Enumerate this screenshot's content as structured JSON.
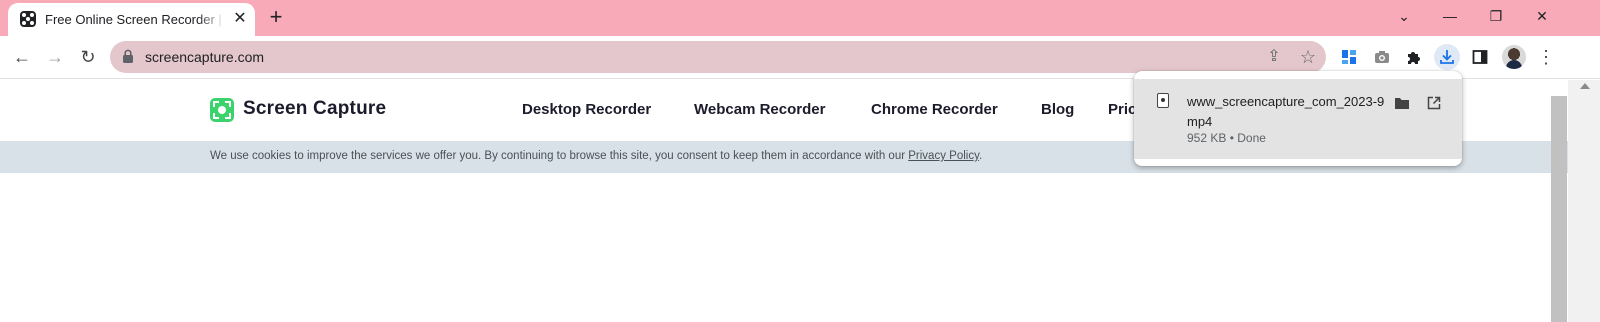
{
  "browser": {
    "tab": {
      "title": "Free Online Screen Recorder | Online Screen Capture",
      "close_glyph": "✕",
      "favicon": "screencapture-favicon-icon"
    },
    "new_tab_glyph": "+",
    "window_controls": {
      "tab_search": "⌄",
      "minimize": "—",
      "restore": "❐",
      "close": "✕"
    },
    "toolbar": {
      "back_glyph": "←",
      "forward_glyph": "→",
      "reload_glyph": "↻",
      "url": "screencapture.com",
      "share_glyph": "⇪",
      "bookmark_glyph": "☆",
      "menu_glyph": "⋮"
    },
    "accent_color": "#f8aab8"
  },
  "page": {
    "logo_text": "Screen Capture",
    "nav": [
      "Desktop Recorder",
      "Webcam Recorder",
      "Chrome Recorder",
      "Blog",
      "Pricing"
    ],
    "cookie": {
      "text": "We use cookies to improve the services we offer you. By continuing to browse this site, you consent to keep them in accordance with our ",
      "link": "Privacy Policy",
      "end": "."
    }
  },
  "download": {
    "filename": "www_screencapture_com_2023-9...mp4",
    "filename_line1": "www_screencapture_com_2023-9",
    "filename_line2": "mp4",
    "status": "952 KB • Done"
  }
}
